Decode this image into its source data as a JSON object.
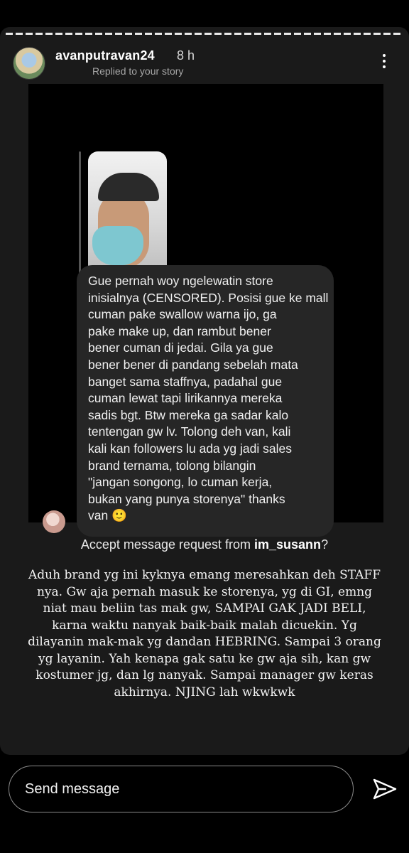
{
  "story": {
    "username": "avanputravan24",
    "time": "8 h",
    "replied_label": "Replied to your story"
  },
  "dm": {
    "message": "Gue pernah woy ngelewatin store\ninisialnya (CENSORED). Posisi gue ke mall\ncuman pake swallow warna ijo, ga\npake make up, dan rambut bener\nbener cuman di jedai. Gila ya gue\nbener bener di pandang sebelah mata\nbanget sama staffnya, padahal gue\ncuman lewat tapi lirikannya mereka\nsadis bgt. Btw  mereka ga sadar kalo\ntentengan gw lv. Tolong deh van, kali\nkali kan followers lu ada yg jadi sales\nbrand ternama, tolong bilangin\n\"jangan songong, lo cuman kerja,\nbukan yang punya storenya\" thanks\nvan 🙂",
    "accept_prefix": "Accept message request from ",
    "accept_user": "im_susann",
    "accept_suffix": "?"
  },
  "caption": "Aduh brand yg ini kyknya emang meresahkan deh STAFF nya. Gw aja pernah masuk ke storenya, yg di GI, emng niat mau beliin tas mak gw, SAMPAI GAK JADI BELI, karna waktu nanyak baik-baik malah dicuekin. Yg dilayanin mak-mak yg dandan HEBRING. Sampai 3 orang yg layanin. Yah kenapa gak satu ke gw aja sih, kan gw kostumer jg, dan lg nanyak. Sampai manager gw keras akhirnya. NJING lah wkwkwk",
  "reply": {
    "placeholder": "Send message"
  },
  "icons": {
    "more": "more-vertical-icon",
    "send": "send-icon"
  }
}
